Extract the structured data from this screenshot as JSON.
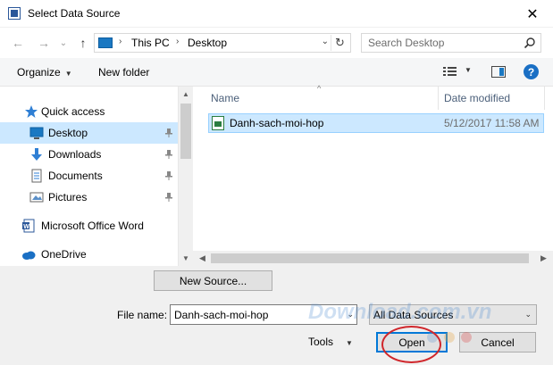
{
  "window": {
    "title": "Select Data Source",
    "close_glyph": "✕"
  },
  "nav": {
    "back_glyph": "←",
    "forward_glyph": "→",
    "recent_glyph": "⌄",
    "up_glyph": "↑",
    "address": [
      "This PC",
      "Desktop"
    ],
    "address_sep": "›",
    "address_dd": "⌄",
    "refresh_glyph": "↻",
    "search_placeholder": "Search Desktop"
  },
  "toolbar": {
    "organize_label": "Organize",
    "new_folder_label": "New folder",
    "help_label": "?",
    "dd_glyph": "▼"
  },
  "sidebar": {
    "items": [
      {
        "label": "Quick access",
        "icon": "star-icon"
      },
      {
        "label": "Desktop",
        "icon": "desktop-folder-icon",
        "selected": true,
        "pinned": true
      },
      {
        "label": "Downloads",
        "icon": "download-arrow-icon",
        "pinned": true
      },
      {
        "label": "Documents",
        "icon": "documents-icon",
        "pinned": true
      },
      {
        "label": "Pictures",
        "icon": "pictures-icon",
        "pinned": true
      },
      {
        "label": "Microsoft Office Word",
        "icon": "word-icon"
      },
      {
        "label": "OneDrive",
        "icon": "cloud-icon"
      }
    ]
  },
  "files": {
    "columns": [
      "Name",
      "Date modified"
    ],
    "sort_glyph": "^",
    "rows": [
      {
        "name": "Danh-sach-moi-hop",
        "date": "5/12/2017 11:58 AM",
        "icon": "spreadsheet-file-icon",
        "selected": true
      }
    ]
  },
  "scroll": {
    "up": "▲",
    "down": "▼",
    "left": "◀",
    "right": "▶"
  },
  "bottom": {
    "new_source_label": "New Source...",
    "file_name_label": "File name:",
    "file_name_value": "Danh-sach-moi-hop",
    "filter_value": "All Data Sources",
    "tools_label": "Tools",
    "open_label": "Open",
    "cancel_label": "Cancel",
    "watermark": "Download.com.vn"
  },
  "colors": {
    "selection": "#cce8ff",
    "accent": "#0078d7",
    "annotation": "#d0262b"
  }
}
